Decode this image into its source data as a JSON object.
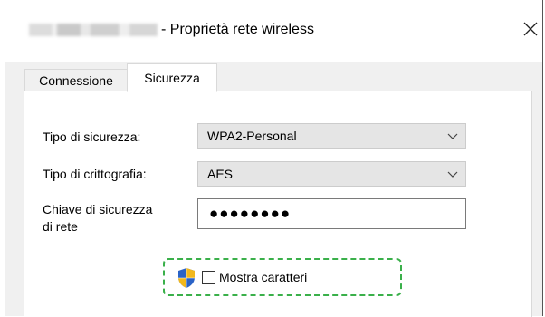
{
  "window": {
    "title": "- Proprietà rete wireless",
    "close_glyph": "✕"
  },
  "tabs": [
    {
      "label": "Connessione",
      "active": false
    },
    {
      "label": "Sicurezza",
      "active": true
    }
  ],
  "form": {
    "security_type_label": "Tipo di sicurezza:",
    "security_type_value": "WPA2-Personal",
    "encryption_type_label": "Tipo di crittografia:",
    "encryption_type_value": "AES",
    "network_key_label_line1": "Chiave di sicurezza",
    "network_key_label_line2": "di rete",
    "network_key_masked": "●●●●●●●●",
    "show_characters_label": "Mostra caratteri",
    "show_characters_checked": false
  },
  "icons": {
    "close": "close-icon",
    "dropdown": "chevron-down-icon",
    "shield": "uac-shield-icon"
  },
  "colors": {
    "highlight_border": "#3ab04a",
    "panel_bg": "#f0f0f0",
    "combo_bg": "#e5e5e5"
  }
}
